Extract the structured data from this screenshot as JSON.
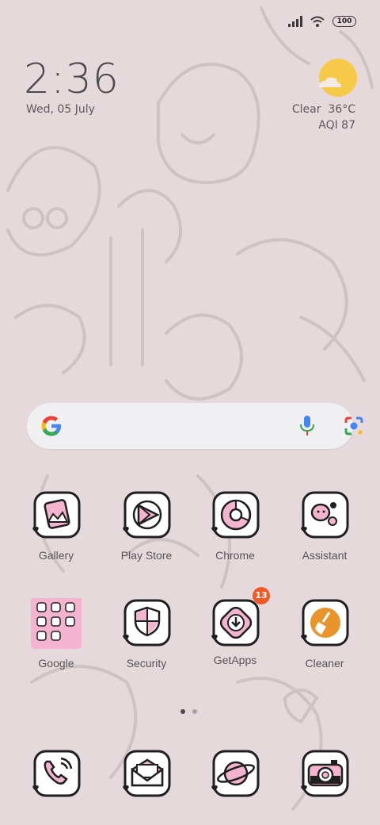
{
  "status_bar": {
    "battery_level": "100",
    "signal_icon": "cellular-signal-icon",
    "wifi_icon": "wifi-icon"
  },
  "clock": {
    "time": "2:36",
    "date": "Wed, 05 July"
  },
  "weather": {
    "condition": "Clear",
    "temperature": "36°C",
    "aqi": "AQI 87",
    "icon": "sun-cloud-icon"
  },
  "search": {
    "placeholder": "",
    "mic_icon": "microphone-icon",
    "lens_icon": "google-lens-icon"
  },
  "apps_row1": [
    {
      "label": "Gallery",
      "icon": "gallery-icon"
    },
    {
      "label": "Play Store",
      "icon": "play-store-icon"
    },
    {
      "label": "Chrome",
      "icon": "chrome-icon"
    },
    {
      "label": "Assistant",
      "icon": "assistant-icon"
    }
  ],
  "apps_row2": [
    {
      "label": "Google",
      "icon": "google-folder-icon"
    },
    {
      "label": "Security",
      "icon": "security-icon"
    },
    {
      "label": "GetApps",
      "icon": "getapps-icon",
      "badge": "13"
    },
    {
      "label": "Cleaner",
      "icon": "cleaner-icon"
    }
  ],
  "dock": [
    {
      "icon": "phone-icon"
    },
    {
      "icon": "messages-icon"
    },
    {
      "icon": "browser-planet-icon"
    },
    {
      "icon": "camera-icon"
    }
  ],
  "pager": {
    "pages": 2,
    "current": 1
  },
  "colors": {
    "background": "#e6d9dc",
    "accent_pink": "#f4b3cf",
    "badge": "#f05a28",
    "sun": "#f7c948"
  }
}
